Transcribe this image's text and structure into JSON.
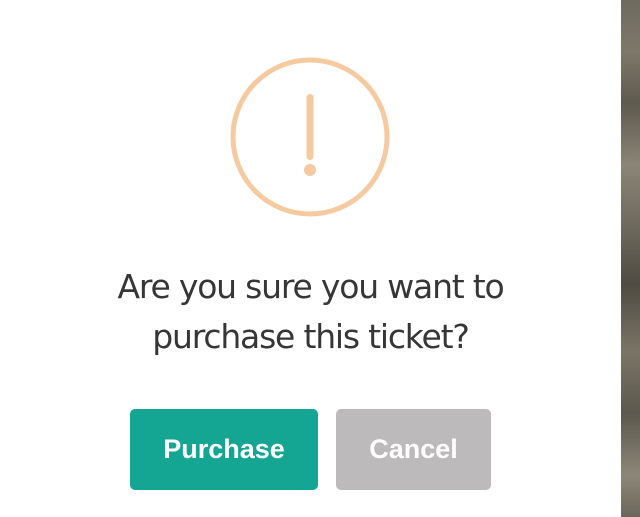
{
  "dialog": {
    "title_line1": "Are you sure you want to",
    "title_line2": "purchase this ticket?",
    "icon": "exclamation-circle-icon",
    "confirm_label": "Purchase",
    "cancel_label": "Cancel"
  },
  "colors": {
    "warning_icon": "#f6caa0",
    "confirm_button": "#14a693",
    "cancel_button": "#bdbabb",
    "title_text": "#363636",
    "button_text": "#ffffff"
  }
}
